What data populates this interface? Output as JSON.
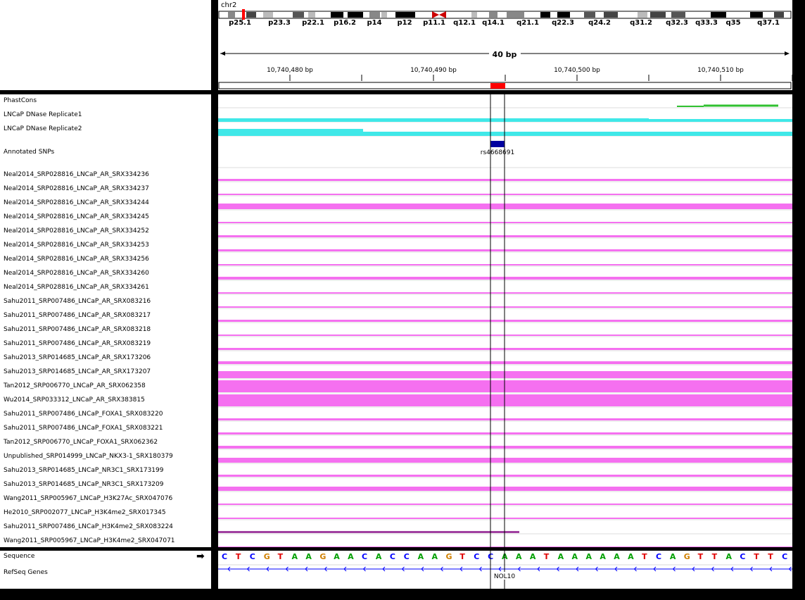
{
  "chromosome": "chr2",
  "cytobands": [
    "p25.1",
    "p23.3",
    "p22.1",
    "p16.2",
    "p14",
    "p12",
    "p11.1",
    "q12.1",
    "q14.1",
    "q21.1",
    "q22.3",
    "q24.2",
    "q31.2",
    "q32.3",
    "q33.3",
    "q35",
    "q37.1"
  ],
  "span_label": "40 bp",
  "ruler_ticks": [
    "10,740,480 bp",
    "10,740,490 bp",
    "10,740,500 bp",
    "10,740,510 bp"
  ],
  "tracks": [
    "PhastCons",
    "LNCaP DNase Replicate1",
    "LNCaP DNase Replicate2",
    "Annotated SNPs",
    "Neal2014_SRP028816_LNCaP_AR_SRX334236",
    "Neal2014_SRP028816_LNCaP_AR_SRX334237",
    "Neal2014_SRP028816_LNCaP_AR_SRX334244",
    "Neal2014_SRP028816_LNCaP_AR_SRX334245",
    "Neal2014_SRP028816_LNCaP_AR_SRX334252",
    "Neal2014_SRP028816_LNCaP_AR_SRX334253",
    "Neal2014_SRP028816_LNCaP_AR_SRX334256",
    "Neal2014_SRP028816_LNCaP_AR_SRX334260",
    "Neal2014_SRP028816_LNCaP_AR_SRX334261",
    "Sahu2011_SRP007486_LNCaP_AR_SRX083216",
    "Sahu2011_SRP007486_LNCaP_AR_SRX083217",
    "Sahu2011_SRP007486_LNCaP_AR_SRX083218",
    "Sahu2011_SRP007486_LNCaP_AR_SRX083219",
    "Sahu2013_SRP014685_LNCaP_AR_SRX173206",
    "Sahu2013_SRP014685_LNCaP_AR_SRX173207",
    "Tan2012_SRP006770_LNCaP_AR_SRX062358",
    "Wu2014_SRP033312_LNCaP_AR_SRX383815",
    "Sahu2011_SRP007486_LNCaP_FOXA1_SRX083220",
    "Sahu2011_SRP007486_LNCaP_FOXA1_SRX083221",
    "Tan2012_SRP006770_LNCaP_FOXA1_SRX062362",
    "Unpublished_SRP014999_LNCaP_NKX3-1_SRX180379",
    "Sahu2013_SRP014685_LNCaP_NR3C1_SRX173199",
    "Sahu2013_SRP014685_LNCaP_NR3C1_SRX173209",
    "Wang2011_SRP005967_LNCaP_H3K27Ac_SRX047076",
    "He2010_SRP002077_LNCaP_H3K4me2_SRX017345",
    "Sahu2011_SRP007486_LNCaP_H3K4me2_SRX083224",
    "Wang2011_SRP005967_LNCaP_H3K4me2_SRX047071"
  ],
  "snp_label": "rs4668691",
  "sequence_label": "Sequence",
  "refseq_label": "RefSeq Genes",
  "sequence": "CTCGTAAGAACACCAAGTCCAAATAAAAAATCAGTTACTTC",
  "gene_label": "NOL10",
  "colors": {
    "signal": "#f570f0",
    "dnase": "#40e8e8",
    "phastcons": "#30c030",
    "snp": "#0000a0",
    "highlight": "#ff0000",
    "gene": "#0000ff"
  },
  "base_colors": {
    "A": "#00a000",
    "C": "#0000ff",
    "G": "#d08000",
    "T": "#e00000"
  }
}
